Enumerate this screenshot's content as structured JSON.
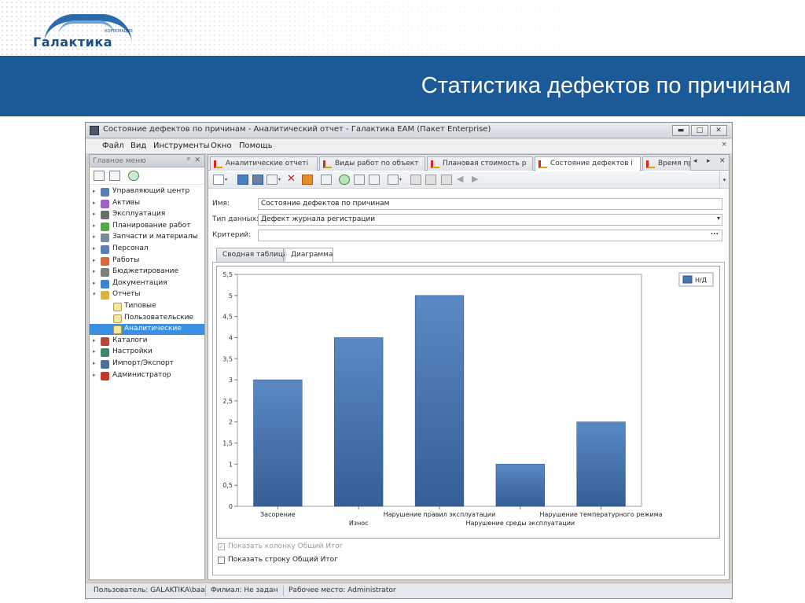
{
  "brand": {
    "corp": "КОРПОРАЦИЯ",
    "name": "Галактика"
  },
  "slide": {
    "title": "Статистика дефектов по причинам"
  },
  "window": {
    "title": "Состояние дефектов по причинам - Аналитический отчет - Галактика EAM (Пакет Enterprise)",
    "buttons": {
      "minimize": "▬",
      "maximize": "□",
      "close": "✕"
    }
  },
  "menu": {
    "items": [
      "Файл",
      "Вид",
      "Инструменты",
      "Окно",
      "Помощь"
    ],
    "close": "×"
  },
  "main_menu": {
    "title": "Главное меню",
    "pin": "ᵖ",
    "close": "✕",
    "items": [
      {
        "label": "Управляющий центр",
        "icon": "control-center-icon",
        "color": "#5b7fb5"
      },
      {
        "label": "Активы",
        "icon": "assets-icon",
        "color": "#9b63c4"
      },
      {
        "label": "Эксплуатация",
        "icon": "operation-icon",
        "color": "#6d6d6d"
      },
      {
        "label": "Планирование работ",
        "icon": "planning-icon",
        "color": "#58a84b"
      },
      {
        "label": "Запчасти и материалы",
        "icon": "parts-icon",
        "color": "#7a8a99"
      },
      {
        "label": "Персонал",
        "icon": "personnel-icon",
        "color": "#5b7fb5"
      },
      {
        "label": "Работы",
        "icon": "works-icon",
        "color": "#d46b3c"
      },
      {
        "label": "Бюджетирование",
        "icon": "budget-icon",
        "color": "#7e7e7e"
      },
      {
        "label": "Документация",
        "icon": "documentation-icon",
        "color": "#3f83c8"
      },
      {
        "label": "Отчеты",
        "icon": "reports-icon",
        "color": "#d8b24a",
        "expanded": true
      }
    ],
    "sub_items": [
      {
        "label": "Типовые"
      },
      {
        "label": "Пользовательские"
      },
      {
        "label": "Аналитические",
        "selected": true
      }
    ],
    "items_after": [
      {
        "label": "Каталоги",
        "icon": "catalogs-icon",
        "color": "#b5473c"
      },
      {
        "label": "Настройки",
        "icon": "settings-icon",
        "color": "#3b8a6e"
      },
      {
        "label": "Импорт/Экспорт",
        "icon": "import-export-icon",
        "color": "#4f6f95"
      },
      {
        "label": "Администратор",
        "icon": "admin-icon",
        "color": "#c0392b"
      }
    ]
  },
  "doc_tabs": [
    {
      "label": "Аналитические отчеті"
    },
    {
      "label": "Виды работ по объект"
    },
    {
      "label": "Плановая стоимость р"
    },
    {
      "label": "Состояние дефектов і",
      "active": true
    },
    {
      "label": "Время пр"
    }
  ],
  "tab_nav": {
    "prev": "◂",
    "next": "▸",
    "close": "✕"
  },
  "form": {
    "name_label": "Имя:",
    "name_value": "Состояние дефектов по причинам",
    "datatype_label": "Тип данных:",
    "datatype_value": "Дефект журнала регистрации",
    "criteria_label": "Критерий:",
    "criteria_value": "",
    "ellipsis": "..."
  },
  "view_tabs": [
    {
      "label": "Сводная таблица"
    },
    {
      "label": "Диаграмма",
      "active": true
    }
  ],
  "checkboxes": [
    {
      "label": "Показать колонку Общий Итог",
      "checked": true,
      "disabled": true
    },
    {
      "label": "Показать строку Общий Итог",
      "checked": false,
      "disabled": false
    }
  ],
  "status": {
    "user": "Пользователь: GALAKTIKA\\baa",
    "branch": "Филиал: Не задан",
    "workplace": "Рабочее место: Administrator"
  },
  "colors": {
    "accent": "#1b5a96",
    "bar": "#4a78b4",
    "selection": "#3a8fe0"
  },
  "chart_data": {
    "type": "bar",
    "categories": [
      "Засорение",
      "Износ",
      "Нарушение правил эксплуатации",
      "Нарушение среды эксплуатации",
      "Нарушение температурного режима"
    ],
    "series": [
      {
        "name": "Н/Д",
        "values": [
          3,
          4,
          5,
          1,
          2
        ]
      }
    ],
    "ylim": [
      0,
      5.5
    ],
    "yticks": [
      "0",
      "0,5",
      "1",
      "1,5",
      "2",
      "2,5",
      "3",
      "3,5",
      "4",
      "4,5",
      "5",
      "5,5"
    ],
    "legend": "top-right",
    "grid": false
  }
}
